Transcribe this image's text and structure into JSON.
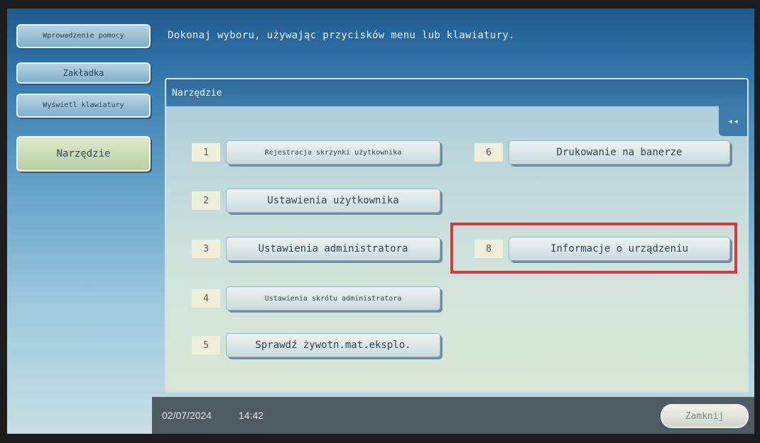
{
  "instruction": "Dokonaj wyboru, używając przycisków menu lub klawiatury.",
  "nav": {
    "item1": "Wprowadzenie pomocy",
    "item2": "Zakładka",
    "item3": "Wyświetl klawiatury",
    "item4": "Narzędzie"
  },
  "panel": {
    "title": "Narzędzie",
    "collapse": "◂◂"
  },
  "menu": {
    "item1": {
      "num": "1",
      "label": "Rejestracja skrzynki użytkownika"
    },
    "item2": {
      "num": "2",
      "label": "Ustawienia użytkownika"
    },
    "item3": {
      "num": "3",
      "label": "Ustawienia administratora"
    },
    "item4": {
      "num": "4",
      "label": "Ustawienia skrótu administratora"
    },
    "item5": {
      "num": "5",
      "label": "Sprawdź żywotn.mat.eksplo."
    },
    "item6": {
      "num": "6",
      "label": "Drukowanie na banerze"
    },
    "item8": {
      "num": "8",
      "label": "Informacje o urządzeniu"
    }
  },
  "footer": {
    "date": "02/07/2024",
    "time": "14:42",
    "close": "Zamknij"
  }
}
